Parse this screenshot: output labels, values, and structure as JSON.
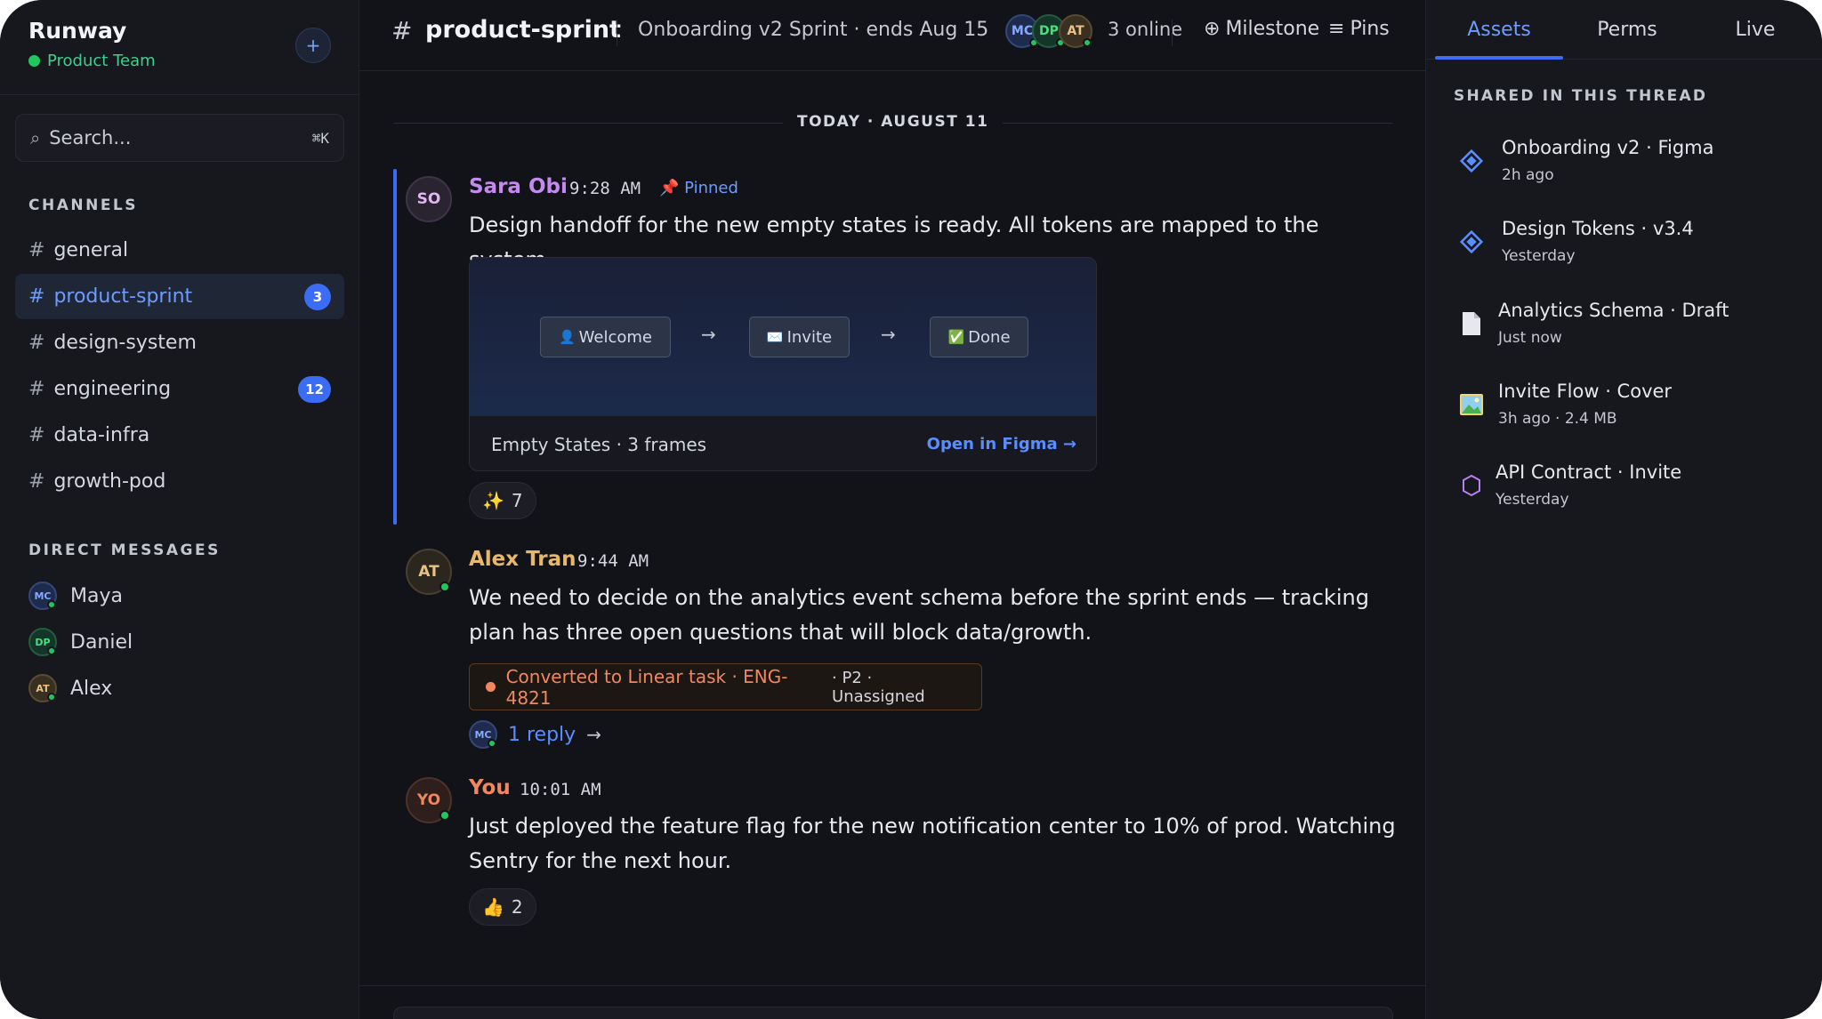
{
  "workspace": {
    "name": "Runway",
    "team": "Product Team",
    "add_icon": "+"
  },
  "search": {
    "placeholder": "Search...",
    "shortcut": "⌘K"
  },
  "sidebar": {
    "channels_label": "CHANNELS",
    "channels": [
      {
        "name": "general",
        "badge": ""
      },
      {
        "name": "product-sprint",
        "badge": "3",
        "active": true
      },
      {
        "name": "design-system",
        "badge": ""
      },
      {
        "name": "engineering",
        "badge": "12"
      },
      {
        "name": "data-infra",
        "badge": ""
      },
      {
        "name": "growth-pod",
        "badge": ""
      }
    ],
    "dms_label": "DIRECT MESSAGES",
    "dms": [
      {
        "name": "Maya",
        "initials": "MC"
      },
      {
        "name": "Daniel",
        "initials": "DP"
      },
      {
        "name": "Alex",
        "initials": "AT"
      }
    ]
  },
  "topbar": {
    "hash": "#",
    "channel": "product-sprint",
    "topic": "Onboarding v2 Sprint · ends Aug 15",
    "avatars": [
      "MC",
      "DP",
      "AT"
    ],
    "online": "3 online",
    "milestone_icon": "⊕",
    "milestone": "Milestone",
    "pins_icon": "≡",
    "pins": "Pins"
  },
  "day_divider": "TODAY · AUGUST 11",
  "messages": [
    {
      "initials": "SO",
      "author": "Sara Obi",
      "time": "9:28 AM",
      "pinned": "Pinned",
      "text": "Design handoff for the new empty states is ready. All tokens are mapped to the system.",
      "attachment": {
        "frames": [
          "Welcome",
          "Invite",
          "Done"
        ],
        "frame_icons": [
          "👤",
          "✉️",
          "✅"
        ],
        "arrow": "→",
        "title": "Empty States · 3 frames",
        "link": "Open in Figma →"
      },
      "reaction": {
        "emoji": "✨",
        "count": "7"
      }
    },
    {
      "initials": "AT",
      "author": "Alex Tran",
      "time": "9:44 AM",
      "text": "We need to decide on the analytics event schema before the sprint ends — tracking plan has three open questions that will block data/growth.",
      "task": {
        "label": "Converted to Linear task · ENG-4821",
        "meta": "· P2 · Unassigned"
      },
      "reply": {
        "avatar": "MC",
        "label": "1 reply",
        "arrow": "→"
      }
    },
    {
      "initials": "YO",
      "author": "You",
      "time": "10:01 AM",
      "text": "Just deployed the feature flag for the new notification center to 10% of prod. Watching Sentry for the next hour.",
      "reaction": {
        "emoji": "👍",
        "count": "2"
      }
    }
  ],
  "right_panel": {
    "tabs": [
      "Assets",
      "Perms",
      "Live"
    ],
    "section_label": "SHARED IN THIS THREAD",
    "assets": [
      {
        "name": "Onboarding v2 · Figma",
        "meta": "2h ago",
        "icon": "figma-diamond-icon"
      },
      {
        "name": "Design Tokens · v3.4",
        "meta": "Yesterday",
        "icon": "figma-diamond-icon"
      },
      {
        "name": "Analytics Schema · Draft",
        "meta": "Just now",
        "icon": "document-icon"
      },
      {
        "name": "Invite Flow · Cover",
        "meta": "3h ago · 2.4 MB",
        "icon": "image-icon"
      },
      {
        "name": "API Contract · Invite",
        "meta": "Yesterday",
        "icon": "hexagon-icon"
      }
    ]
  },
  "colors": {
    "accent": "#3b6cf5",
    "online": "#22c55e",
    "author_sara": "#c58af0",
    "author_alex": "#e8b86a",
    "author_you": "#f0875f"
  }
}
